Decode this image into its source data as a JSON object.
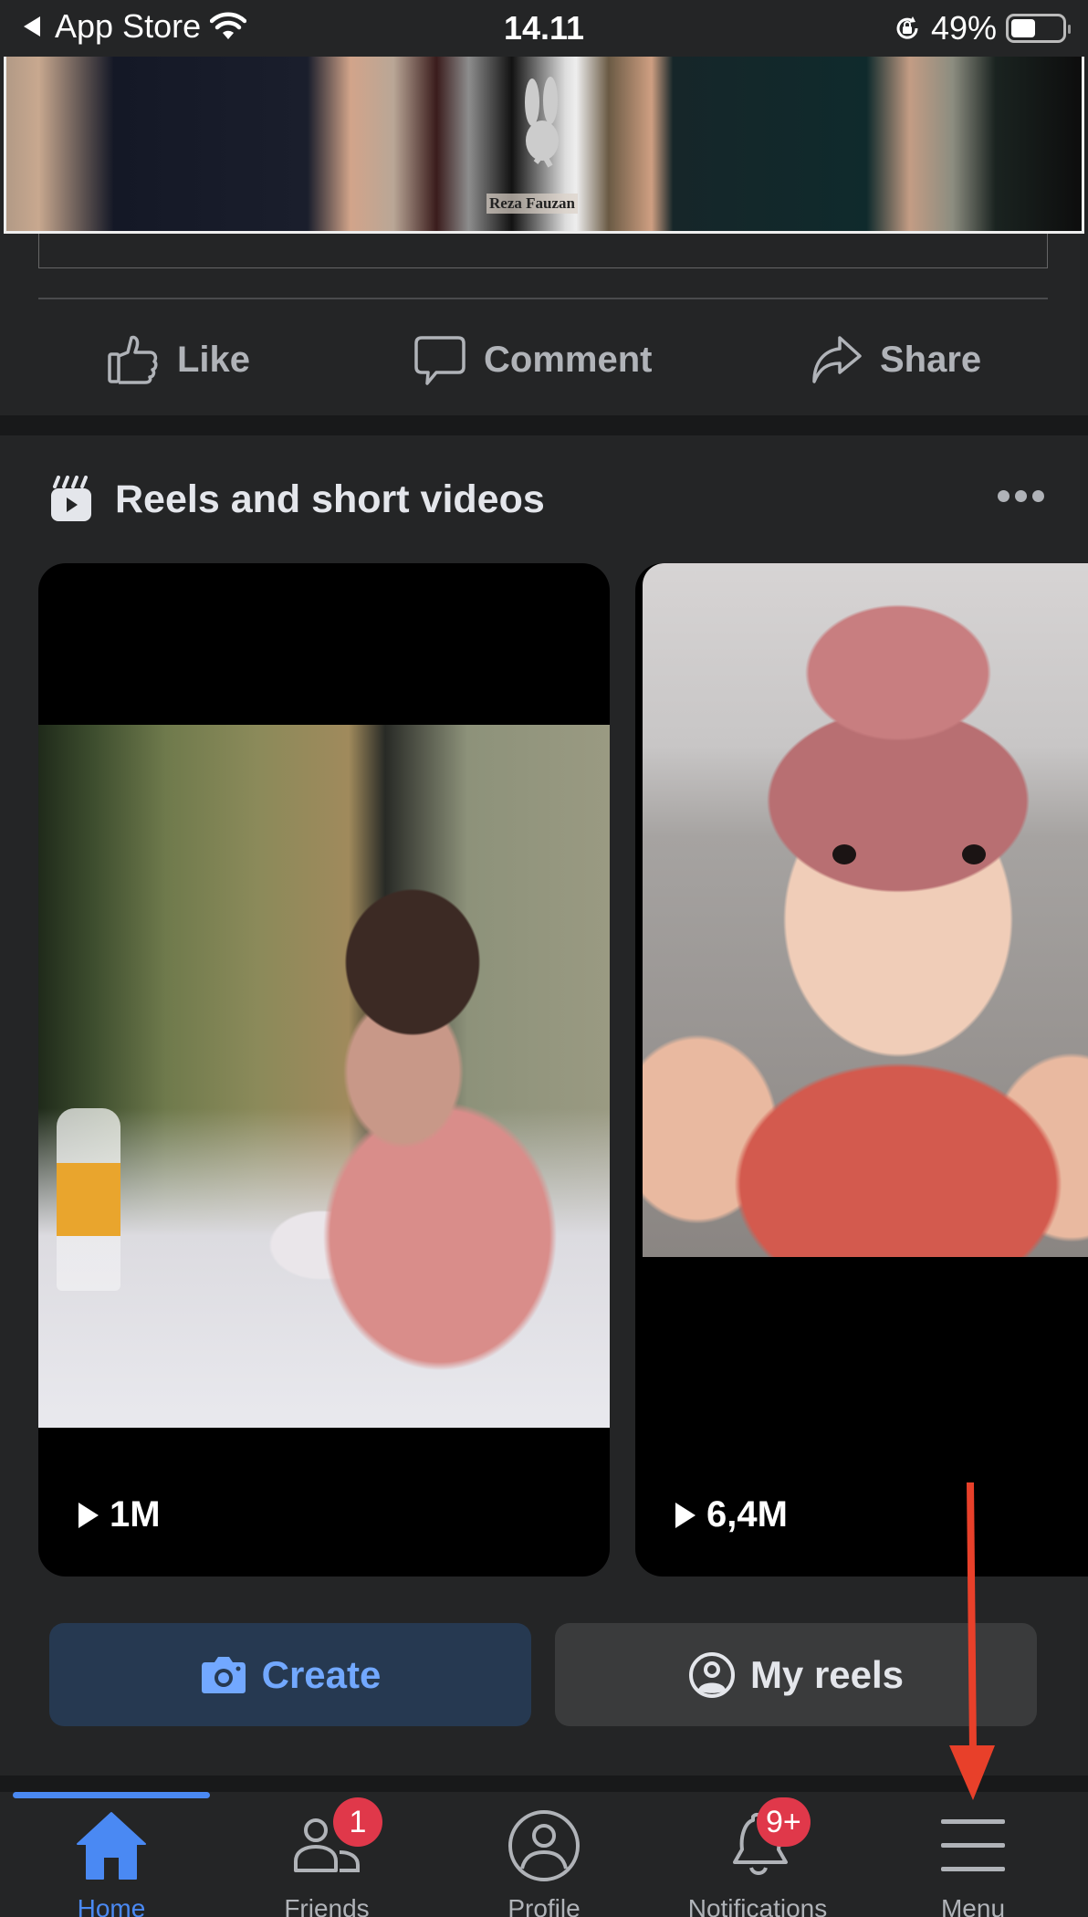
{
  "status_bar": {
    "back_app": "App Store",
    "time": "14.11",
    "battery_percent": "49%",
    "battery_level": 0.49
  },
  "post": {
    "image_watermark": "Reza Fauzan",
    "actions": [
      {
        "label": "Like",
        "icon": "thumbs-up-icon"
      },
      {
        "label": "Comment",
        "icon": "comment-bubble-icon"
      },
      {
        "label": "Share",
        "icon": "share-arrow-icon"
      }
    ]
  },
  "reels": {
    "title": "Reels and short videos",
    "icon": "reels-icon",
    "more_icon": "more-dots-icon",
    "items": [
      {
        "views": "1M",
        "thumbnail": "woman eating dessert at restaurant table"
      },
      {
        "views": "6,4M",
        "thumbnail": "baby in pink turban held by hands"
      }
    ],
    "buttons": {
      "create": "Create",
      "my_reels": "My reels"
    }
  },
  "bottom_nav": {
    "active": "Home",
    "items": [
      {
        "label": "Home",
        "icon": "home-icon",
        "badge": null
      },
      {
        "label": "Friends",
        "icon": "friends-icon",
        "badge": "1"
      },
      {
        "label": "Profile",
        "icon": "profile-icon",
        "badge": null
      },
      {
        "label": "Notifications",
        "icon": "bell-icon",
        "badge": "9+"
      },
      {
        "label": "Menu",
        "icon": "hamburger-menu-icon",
        "badge": null
      }
    ]
  },
  "annotation": {
    "type": "red-arrow",
    "points_to": "Menu"
  },
  "colors": {
    "background": "#242526",
    "accent_blue": "#4a89f3",
    "badge_red": "#e0384a",
    "create_button_bg": "#263951",
    "secondary_button_bg": "#3a3b3c",
    "annotation_red": "#e8402a"
  }
}
